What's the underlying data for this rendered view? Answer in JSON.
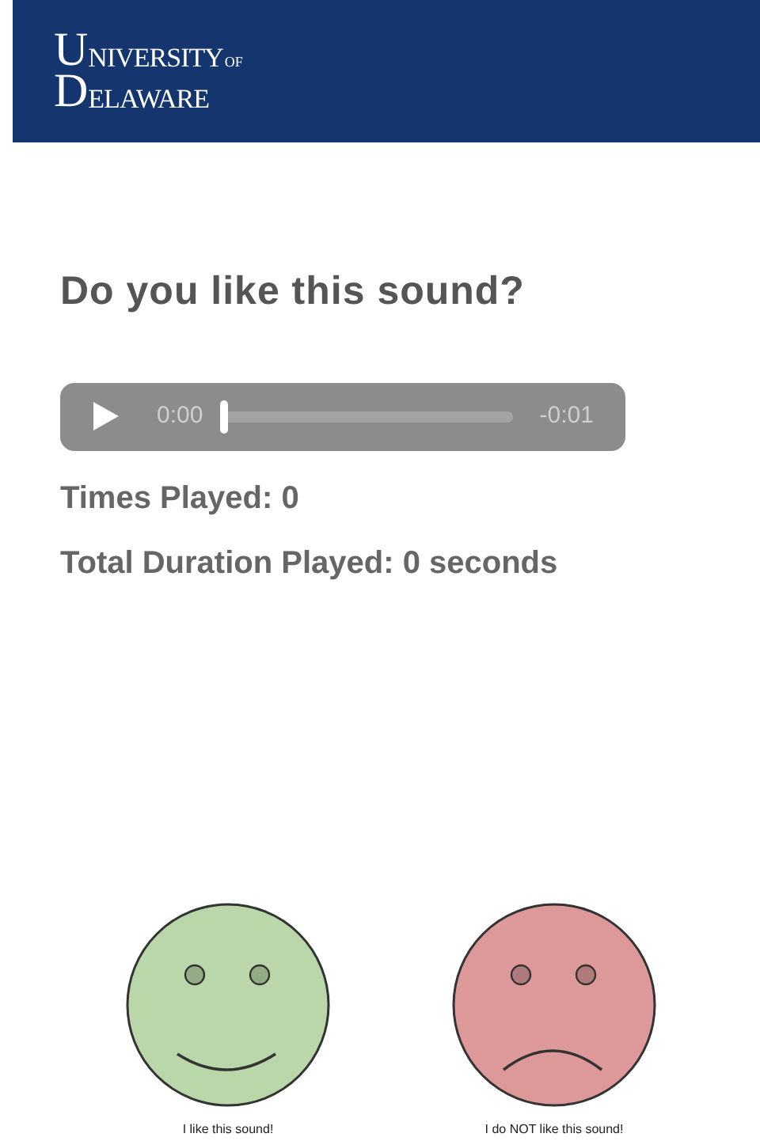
{
  "header": {
    "logo": [
      {
        "initial": "U",
        "rest": "NIVERSITY",
        "suffix": "OF"
      },
      {
        "initial": "D",
        "rest": "ELAWARE"
      }
    ]
  },
  "question": "Do you like this sound?",
  "player": {
    "elapsed": "0:00",
    "remaining": "-0:01",
    "level": 0
  },
  "stats": [
    "Times Played: 0",
    "Total Duration Played: 0 seconds"
  ],
  "choices": [
    {
      "kind": "happy",
      "color": "#b9d7a8",
      "label": "I like this sound!"
    },
    {
      "kind": "sad",
      "color": "#dd9999",
      "label": "I do NOT like this sound!"
    }
  ]
}
